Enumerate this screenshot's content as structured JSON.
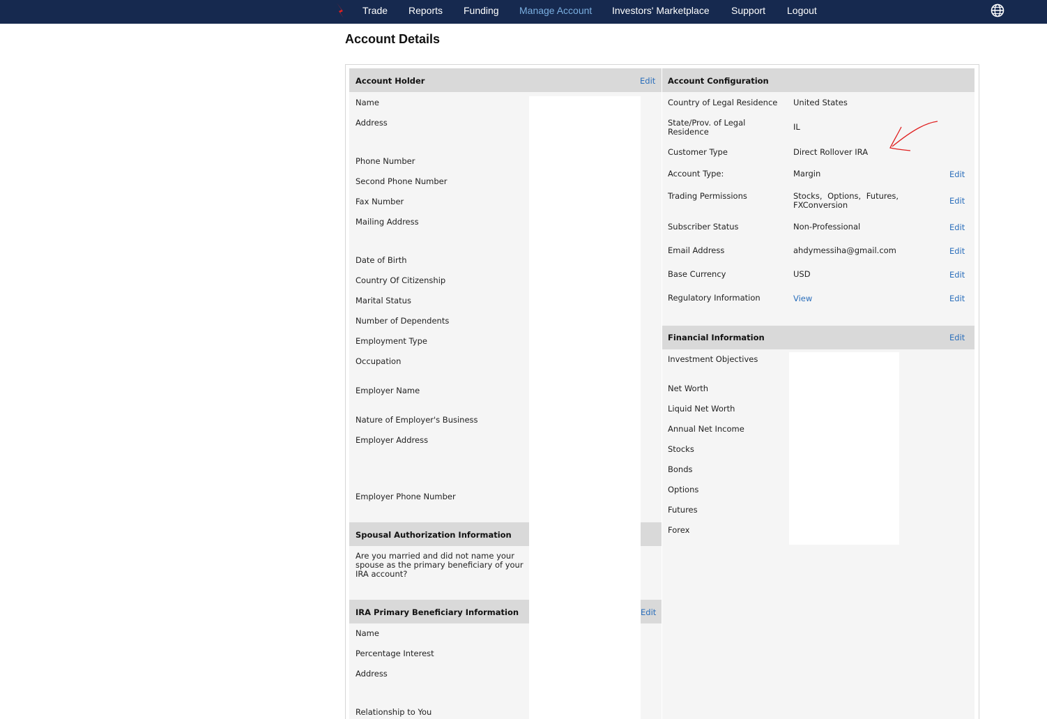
{
  "nav": {
    "items": [
      "Trade",
      "Reports",
      "Funding",
      "Manage Account",
      "Investors' Marketplace",
      "Support",
      "Logout"
    ],
    "active": "Manage Account",
    "brand_color": "#16294f",
    "logo_icon": "brand-logo-icon",
    "globe_icon": "globe-icon"
  },
  "page": {
    "title": "Account Details"
  },
  "account_holder": {
    "title": "Account Holder",
    "edit": "Edit",
    "labels": [
      "Name",
      "Address",
      "Phone Number",
      "Second Phone Number",
      "Fax Number",
      "Mailing Address",
      "Date of Birth",
      "Country Of Citizenship",
      "Marital Status",
      "Number of Dependents",
      "Employment Type",
      "Occupation",
      "Employer Name",
      "Nature of Employer's Business",
      "Employer Address",
      "Employer Phone Number"
    ]
  },
  "spousal": {
    "title": "Spousal Authorization Information",
    "question": "Are you married and did not name your spouse as the primary beneficiary of your IRA account?"
  },
  "beneficiary": {
    "title": "IRA Primary Beneficiary Information",
    "edit": "Edit",
    "labels": [
      "Name",
      "Percentage Interest",
      "Address",
      "Relationship to You"
    ]
  },
  "config": {
    "title": "Account Configuration",
    "rows": [
      {
        "label": "Country of Legal Residence",
        "value": "United States"
      },
      {
        "label": "State/Prov. of Legal Residence",
        "value": "IL"
      },
      {
        "label": "Customer Type",
        "value": "Direct Rollover IRA"
      },
      {
        "label": "Account Type:",
        "value": "Margin",
        "edit": "Edit"
      },
      {
        "label": "Trading Permissions",
        "value": "Stocks, Options, Futures, FXConversion",
        "edit": "Edit"
      },
      {
        "label": "Subscriber Status",
        "value": "Non-Professional",
        "edit": "Edit"
      },
      {
        "label": "Email Address",
        "value": "ahdymessiha@gmail.com",
        "edit": "Edit"
      },
      {
        "label": "Base Currency",
        "value": "USD",
        "edit": "Edit"
      },
      {
        "label": "Regulatory Information",
        "value": "View",
        "edit": "Edit"
      }
    ]
  },
  "financial": {
    "title": "Financial Information",
    "edit": "Edit",
    "labels": [
      "Investment Objectives",
      "Net Worth",
      "Liquid Net Worth",
      "Annual Net Income",
      "Stocks",
      "Bonds",
      "Options",
      "Futures",
      "Forex"
    ]
  },
  "colors": {
    "link": "#2a6ebb",
    "header_bg": "#d9d9d9",
    "panel_bg": "#f5f5f5",
    "annotation": "#e02020"
  },
  "annotation": {
    "icon": "red-arrow-annotation-icon"
  }
}
